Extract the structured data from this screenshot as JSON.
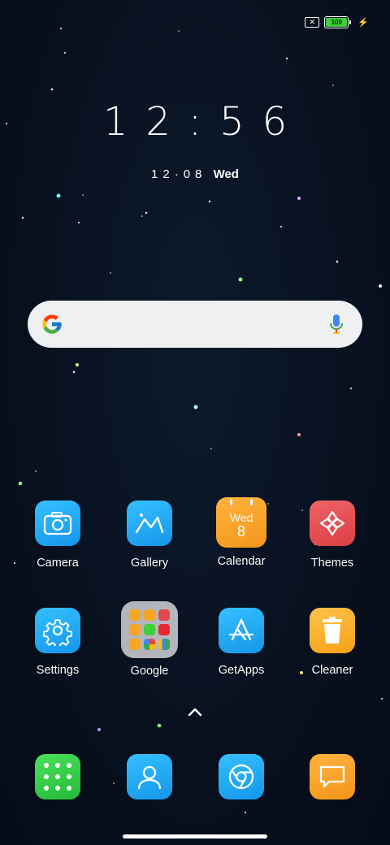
{
  "status_bar": {
    "sim_icon": "no-sim-icon",
    "battery_level": "100",
    "charging_icon": "bolt-icon"
  },
  "clock": {
    "time": "12:56",
    "date": "12·08",
    "weekday": "Wed"
  },
  "search": {
    "google_icon": "google-g-icon",
    "mic_icon": "microphone-icon"
  },
  "apps": [
    {
      "label": "Camera",
      "icon": "camera-icon"
    },
    {
      "label": "Gallery",
      "icon": "gallery-icon"
    },
    {
      "label": "Calendar",
      "icon": "calendar-icon",
      "weekday": "Wed",
      "day": "8"
    },
    {
      "label": "Themes",
      "icon": "themes-icon"
    },
    {
      "label": "Settings",
      "icon": "gear-icon"
    },
    {
      "label": "Google",
      "icon": "google-folder-icon"
    },
    {
      "label": "GetApps",
      "icon": "getapps-icon"
    },
    {
      "label": "Cleaner",
      "icon": "trash-icon"
    }
  ],
  "dock": [
    {
      "icon": "app-drawer-icon"
    },
    {
      "icon": "contacts-icon"
    },
    {
      "icon": "browser-icon"
    },
    {
      "icon": "messages-icon"
    }
  ],
  "colors": {
    "blue": "#1aa3f0",
    "orange": "#f5a623",
    "red": "#e0484d",
    "green": "#3ecf3a"
  }
}
